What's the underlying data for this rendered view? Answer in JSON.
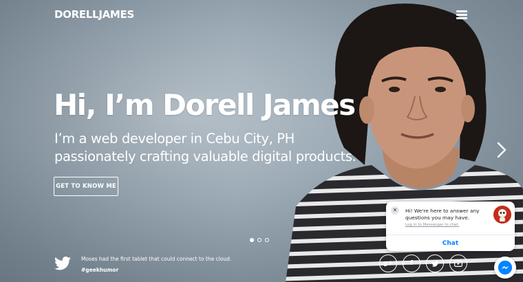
{
  "brand": {
    "name": "DORELLJAMES"
  },
  "hero": {
    "title": "Hi, I’m Dorell James",
    "subtitle_line1": "I’m a web developer in Cebu City, PH",
    "subtitle_line2": "passionately crafting valuable digital products.",
    "cta_label": "GET TO KNOW ME"
  },
  "slider": {
    "dots": 3,
    "active": 0
  },
  "tweet": {
    "text": "Moses had the first tablet that could connect to the cloud.",
    "tag": "#geekhumor"
  },
  "socials": [
    {
      "name": "google-plus",
      "glyph": "g+"
    },
    {
      "name": "facebook",
      "glyph": "f"
    },
    {
      "name": "twitter",
      "glyph": "t"
    },
    {
      "name": "youtube",
      "glyph": "▶"
    }
  ],
  "chat": {
    "message": "Hi! We're here to answer any questions you may have.",
    "login_link": "Log in to Messenger to chat.",
    "button_label": "Chat"
  },
  "colors": {
    "messenger_blue": "#0084ff",
    "chat_avatar_red": "#c62c1c"
  }
}
